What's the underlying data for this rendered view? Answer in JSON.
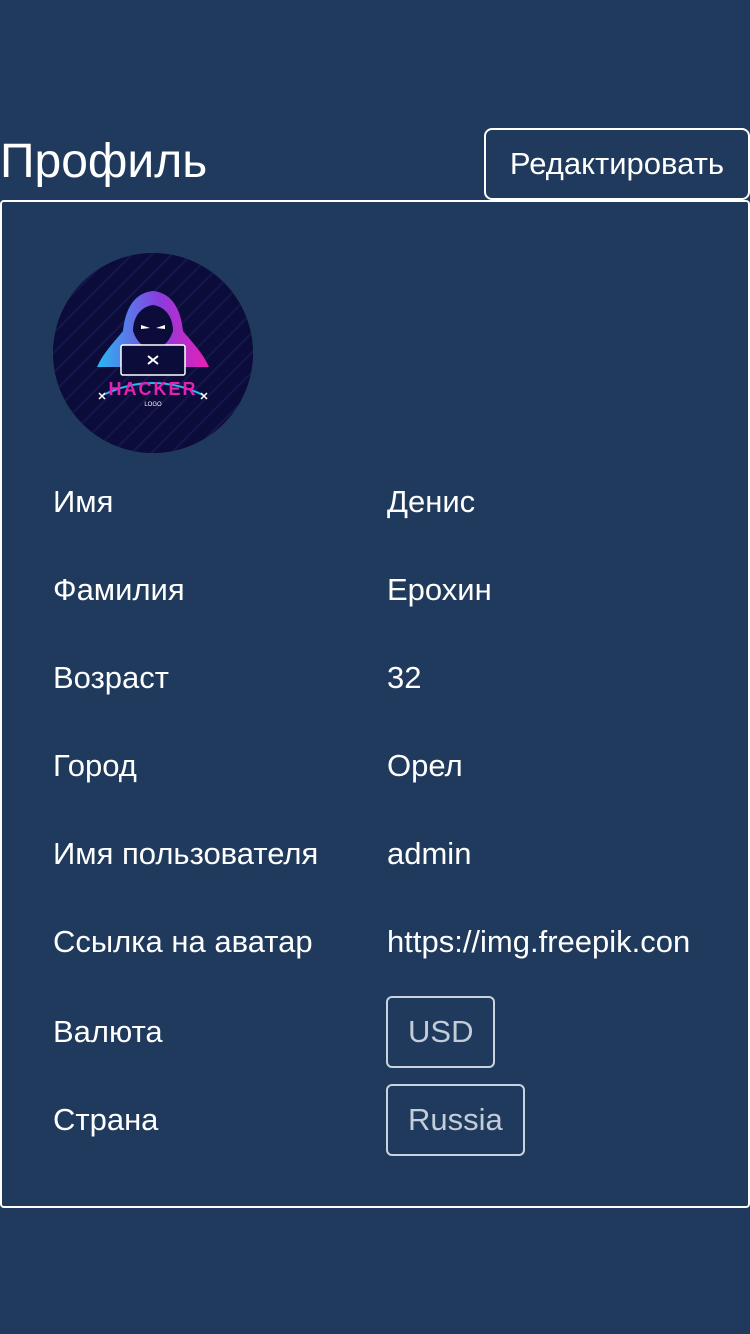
{
  "header": {
    "title": "Профиль",
    "edit_label": "Редактировать"
  },
  "profile": {
    "avatar": {
      "icon": "hacker-logo",
      "logo_text": "HACKER",
      "logo_subtext": "LOGO"
    },
    "fields": [
      {
        "label": "Имя",
        "value": "Денис"
      },
      {
        "label": "Фамилия",
        "value": "Ерохин"
      },
      {
        "label": "Возраст",
        "value": "32"
      },
      {
        "label": "Город",
        "value": "Орел"
      },
      {
        "label": "Имя пользователя",
        "value": "admin"
      },
      {
        "label": "Ссылка на аватар",
        "value": "https://img.freepik.con"
      }
    ],
    "currency": {
      "label": "Валюта",
      "value": "USD"
    },
    "country": {
      "label": "Страна",
      "value": "Russia"
    }
  },
  "colors": {
    "background": "#1f3a5c",
    "text": "#ffffff",
    "select_text": "#c3ccd8",
    "logo_pink": "#e91fb5",
    "logo_blue": "#27b8f2",
    "logo_bg": "#0c0c3a"
  }
}
